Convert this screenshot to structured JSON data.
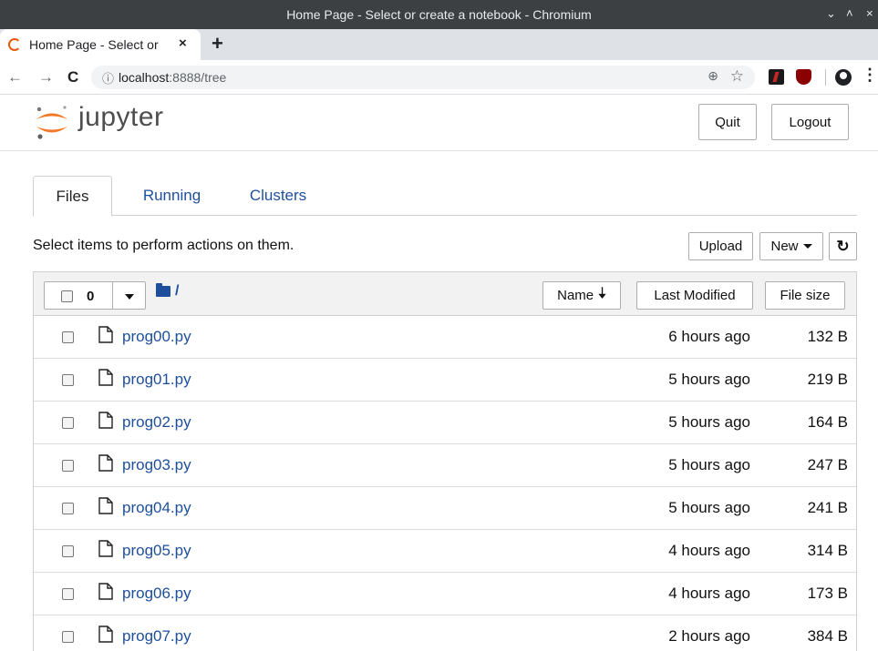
{
  "window": {
    "title": "Home Page - Select or create a notebook - Chromium",
    "minimize_glyph": "⌄",
    "maximize_glyph": "˄",
    "close_glyph": "×"
  },
  "browser": {
    "tab_label": "Home Page - Select or",
    "tab_close": "×",
    "new_tab": "+",
    "back": "←",
    "forward": "→",
    "reload": "C",
    "info_glyph": "ⓘ",
    "url_host": "localhost",
    "url_path": ":8888/tree",
    "zoom_glyph": "⊕",
    "star_glyph": "☆",
    "menu_glyph": "⋮"
  },
  "header": {
    "logo_text": "jupyter",
    "quit_label": "Quit",
    "logout_label": "Logout"
  },
  "tabs": [
    {
      "label": "Files",
      "active": true
    },
    {
      "label": "Running",
      "active": false
    },
    {
      "label": "Clusters",
      "active": false
    }
  ],
  "actions": {
    "hint": "Select items to perform actions on them.",
    "upload_label": "Upload",
    "new_label": "New",
    "refresh_glyph": "↻"
  },
  "list_header": {
    "selected_count": "0",
    "breadcrumb": "/",
    "name_label": "Name",
    "name_sort_glyph": "🡣",
    "modified_label": "Last Modified",
    "size_label": "File size"
  },
  "files": [
    {
      "name": "prog00.py",
      "modified": "6 hours ago",
      "size": "132 B"
    },
    {
      "name": "prog01.py",
      "modified": "5 hours ago",
      "size": "219 B"
    },
    {
      "name": "prog02.py",
      "modified": "5 hours ago",
      "size": "164 B"
    },
    {
      "name": "prog03.py",
      "modified": "5 hours ago",
      "size": "247 B"
    },
    {
      "name": "prog04.py",
      "modified": "5 hours ago",
      "size": "241 B"
    },
    {
      "name": "prog05.py",
      "modified": "4 hours ago",
      "size": "314 B"
    },
    {
      "name": "prog06.py",
      "modified": "4 hours ago",
      "size": "173 B"
    },
    {
      "name": "prog07.py",
      "modified": "2 hours ago",
      "size": "384 B"
    }
  ],
  "colors": {
    "link": "#1e4f9c",
    "logo_orange": "#f37726",
    "titlebar": "#3c4043"
  }
}
